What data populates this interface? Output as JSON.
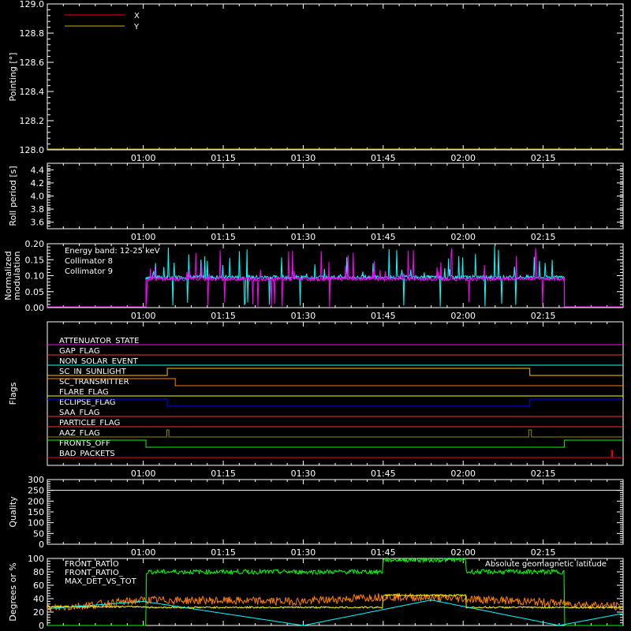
{
  "x_axis": {
    "tick_labels": [
      "01:00",
      "01:15",
      "01:30",
      "01:45",
      "02:00",
      "02:15"
    ],
    "tick_minutes": [
      60,
      75,
      90,
      105,
      120,
      135
    ],
    "range_minutes": [
      42,
      150
    ]
  },
  "chart_data": [
    {
      "id": "pointing",
      "type": "line",
      "ylabel": "Pointing [°]",
      "ylim": [
        128.0,
        129.0
      ],
      "yticks": [
        "128.0",
        "128.2",
        "128.4",
        "128.6",
        "128.8",
        "129.0"
      ],
      "legend": [
        {
          "name": "X",
          "color": "#ff0000"
        },
        {
          "name": "Y",
          "color": "#c8b400"
        }
      ],
      "series": [
        {
          "name": "Y",
          "color": "#c8b400",
          "x": [
            42,
            150
          ],
          "y": [
            128.0,
            128.0
          ]
        }
      ]
    },
    {
      "id": "roll",
      "type": "line",
      "ylabel": "Roll period [s]",
      "ylim": [
        3.5,
        4.5
      ],
      "yticks": [
        "3.6",
        "3.8",
        "4.0",
        "4.2",
        "4.4"
      ],
      "series": []
    },
    {
      "id": "modulation",
      "type": "line",
      "ylabel": "Normalized modulation",
      "ylabel_lines": [
        "Normalized",
        "modulation"
      ],
      "ylim": [
        0.0,
        0.2
      ],
      "yticks": [
        "0.00",
        "0.05",
        "0.10",
        "0.15",
        "0.20"
      ],
      "annotation": "Energy band: 12-25 keV",
      "legend": [
        {
          "name": "Collimator 8",
          "color": "#00ffff"
        },
        {
          "name": "Collimator 9",
          "color": "#ff00ff"
        }
      ],
      "series": [
        {
          "name": "Collimator 8",
          "color": "#00ffff",
          "x": [
            42,
            60.5,
            60.5,
            139,
            139,
            150
          ],
          "y": [
            0,
            0,
            0.095,
            0.095,
            0,
            0
          ]
        },
        {
          "name": "Collimator 9",
          "color": "#ff00ff",
          "x": [
            42,
            60.5,
            60.5,
            139,
            139,
            150
          ],
          "y": [
            0,
            0,
            0.09,
            0.09,
            0,
            0
          ]
        }
      ]
    },
    {
      "id": "flags",
      "type": "line",
      "ylabel": "Flags",
      "flags": [
        {
          "name": "ATTENUATOR_STATE",
          "color": "#ff00ff",
          "steps": []
        },
        {
          "name": "GAP_FLAG",
          "color": "#ff3030",
          "steps": []
        },
        {
          "name": "NON_SOLAR_EVENT",
          "color": "#00ffff",
          "steps": []
        },
        {
          "name": "SC_IN_SUNLIGHT",
          "color": "#ffc000",
          "steps": [
            [
              42,
              0
            ],
            [
              64.5,
              1
            ],
            [
              132.5,
              0
            ]
          ]
        },
        {
          "name": "SC_TRANSMITTER",
          "color": "#ff8000",
          "steps": [
            [
              42,
              1
            ],
            [
              66,
              0
            ]
          ]
        },
        {
          "name": "FLARE_FLAG",
          "color": "#ffff00",
          "steps": []
        },
        {
          "name": "ECLIPSE_FLAG",
          "color": "#0000ff",
          "steps": [
            [
              42,
              1
            ],
            [
              64.5,
              0
            ],
            [
              132.5,
              1
            ]
          ]
        },
        {
          "name": "SAA_FLAG",
          "color": "#ff3030",
          "steps": []
        },
        {
          "name": "PARTICLE_FLAG",
          "color": "#ff3030",
          "steps": []
        },
        {
          "name": "AAZ_FLAG",
          "color": "#8c8c00",
          "steps": [
            [
              42,
              0
            ],
            [
              64.4,
              1
            ],
            [
              64.8,
              0
            ],
            [
              132.3,
              1
            ],
            [
              132.8,
              0
            ]
          ]
        },
        {
          "name": "FRONTS_OFF",
          "color": "#00ff00",
          "steps": [
            [
              42,
              1
            ],
            [
              60.5,
              0
            ],
            [
              139,
              1
            ]
          ]
        },
        {
          "name": "BAD_PACKETS",
          "color": "#ff0000",
          "steps": [
            [
              42,
              0
            ],
            [
              147.8,
              1
            ],
            [
              148,
              0
            ]
          ]
        }
      ]
    },
    {
      "id": "quality",
      "type": "line",
      "ylabel": "Quality",
      "ylim": [
        0,
        300
      ],
      "yticks": [
        "0",
        "50",
        "100",
        "150",
        "200",
        "250",
        "300"
      ],
      "series": [
        {
          "name": "Quality",
          "color": "#ffffff",
          "x": [
            42,
            150
          ],
          "y": [
            250,
            250
          ]
        }
      ]
    },
    {
      "id": "ratios",
      "type": "line",
      "ylabel": "Degrees or %",
      "ylim": [
        0,
        100
      ],
      "yticks": [
        "0",
        "20",
        "40",
        "60",
        "80",
        "100"
      ],
      "legend": [
        {
          "name": "FRONT_RATIO",
          "color": "#ffff00"
        },
        {
          "name": "FRONT_RATIO_",
          "color": "#00ff00"
        },
        {
          "name": "MAX_DET_VS_TOT",
          "color": "#ff8000"
        },
        {
          "name": "Absolute geomagnetic latitude",
          "color": "#00ffff"
        }
      ],
      "series": [
        {
          "name": "FRONT_RATIO",
          "color": "#ffff00",
          "x": [
            42,
            60.5,
            60.5,
            105,
            105,
            120.5,
            120.5,
            150
          ],
          "y": [
            28,
            28,
            27,
            27,
            45,
            45,
            27,
            27
          ]
        },
        {
          "name": "FRONT_RATIO_",
          "color": "#00ff00",
          "x": [
            42,
            60.5,
            60.5,
            105,
            105,
            120.5,
            120.5,
            139,
            139,
            150
          ],
          "y": [
            0,
            0,
            80,
            80,
            98,
            98,
            80,
            80,
            0,
            0
          ]
        },
        {
          "name": "MAX_DET_VS_TOT",
          "color": "#ff8000",
          "x": [
            42,
            60.5,
            90,
            105,
            120.5,
            139,
            150
          ],
          "y": [
            25,
            38,
            36,
            43,
            40,
            33,
            28
          ]
        },
        {
          "name": "Absolute geomagnetic latitude",
          "color": "#00ffff",
          "x": [
            42,
            60,
            90,
            114,
            138,
            150
          ],
          "y": [
            25,
            36,
            0,
            38,
            0,
            18
          ]
        }
      ]
    }
  ]
}
